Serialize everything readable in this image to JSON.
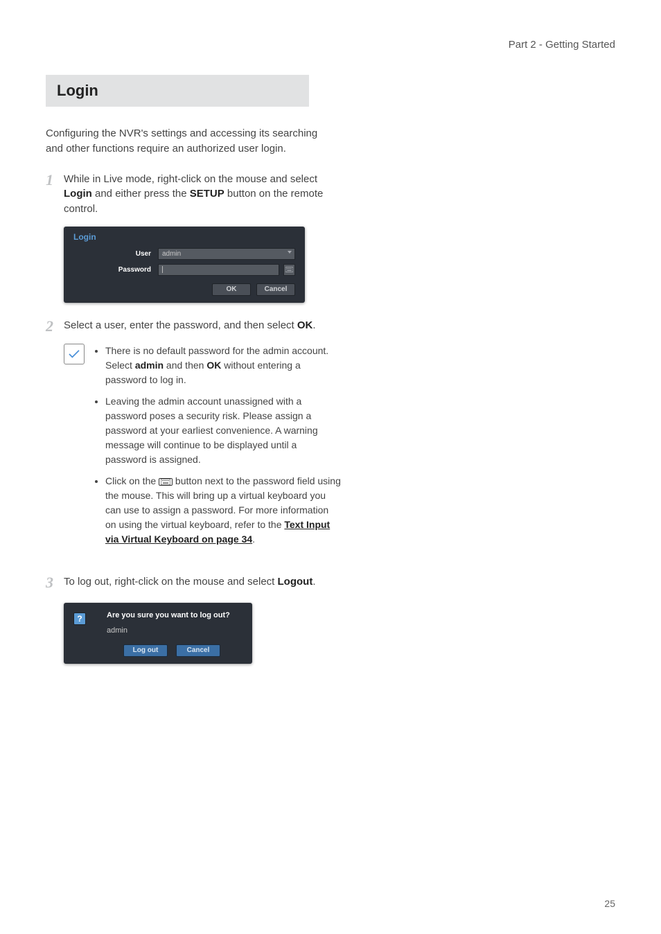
{
  "header": {
    "breadcrumb": "Part 2 - Getting Started"
  },
  "section": {
    "title": "Login"
  },
  "intro": "Configuring the NVR's settings and accessing its searching and other functions require an authorized user login.",
  "steps": {
    "s1": {
      "num": "1",
      "pre": "While in Live mode, right-click on the mouse and select ",
      "b1": "Login",
      "mid": " and either press the ",
      "b2": "SETUP",
      "post": " button on the remote control."
    },
    "s2": {
      "num": "2",
      "pre": "Select a user, enter the password, and then select ",
      "b1": "OK",
      "post": "."
    },
    "s3": {
      "num": "3",
      "pre": "To log out, right-click on the mouse and select ",
      "b1": "Logout",
      "post": "."
    }
  },
  "loginDialog": {
    "title": "Login",
    "userLabel": "User",
    "userValue": "admin",
    "passwordLabel": "Password",
    "ok": "OK",
    "cancel": "Cancel"
  },
  "notes": {
    "n1": {
      "pre": "There is no default password for the admin account. Select ",
      "b1": "admin",
      "mid": " and then ",
      "b2": "OK",
      "post": " without entering a password to log in."
    },
    "n2": "Leaving the admin account unassigned with a password poses a security risk. Please assign a password at your earliest convenience. A warning message will continue to be displayed until a password is assigned.",
    "n3": {
      "pre": "Click on the ",
      "post1": " button next to the password field using the mouse. This will bring up a virtual keyboard you can use to assign a password. For more information on using the virtual keyboard, refer to the ",
      "link": "Text Input via Virtual Keyboard on page 34",
      "post2": "."
    }
  },
  "logoutDialog": {
    "message": "Are you sure you want to log out?",
    "user": "admin",
    "logout": "Log out",
    "cancel": "Cancel"
  },
  "pageNumber": "25"
}
